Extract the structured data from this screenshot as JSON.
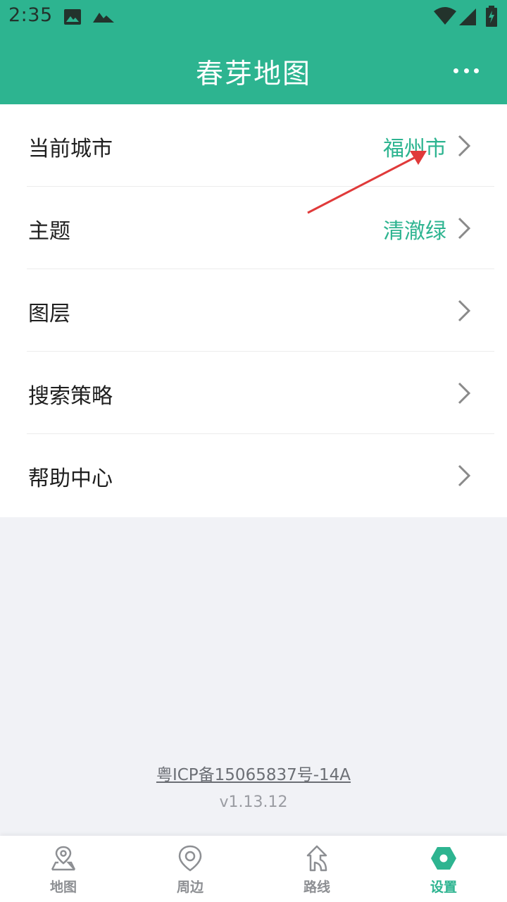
{
  "status_bar": {
    "time": "2:35",
    "icons": [
      "image-icon",
      "mountain-icon",
      "wifi-icon",
      "signal-icon",
      "battery-charging-icon"
    ]
  },
  "header": {
    "title": "春芽地图",
    "more_icon": "more-horizontal-icon"
  },
  "menu": [
    {
      "label": "当前城市",
      "value": "福州市"
    },
    {
      "label": "主题",
      "value": "清澈绿"
    },
    {
      "label": "图层",
      "value": ""
    },
    {
      "label": "搜索策略",
      "value": ""
    },
    {
      "label": "帮助中心",
      "value": ""
    }
  ],
  "footer": {
    "icp": "粤ICP备15065837号-14A",
    "version": "v1.13.12"
  },
  "bottom_nav": [
    {
      "label": "地图",
      "icon": "map-pin-icon",
      "active": false
    },
    {
      "label": "周边",
      "icon": "location-icon",
      "active": false
    },
    {
      "label": "路线",
      "icon": "route-arrow-icon",
      "active": false
    },
    {
      "label": "设置",
      "icon": "settings-hexagon-icon",
      "active": true
    }
  ],
  "colors": {
    "accent": "#2db490",
    "annotation": "#e03a3a"
  }
}
